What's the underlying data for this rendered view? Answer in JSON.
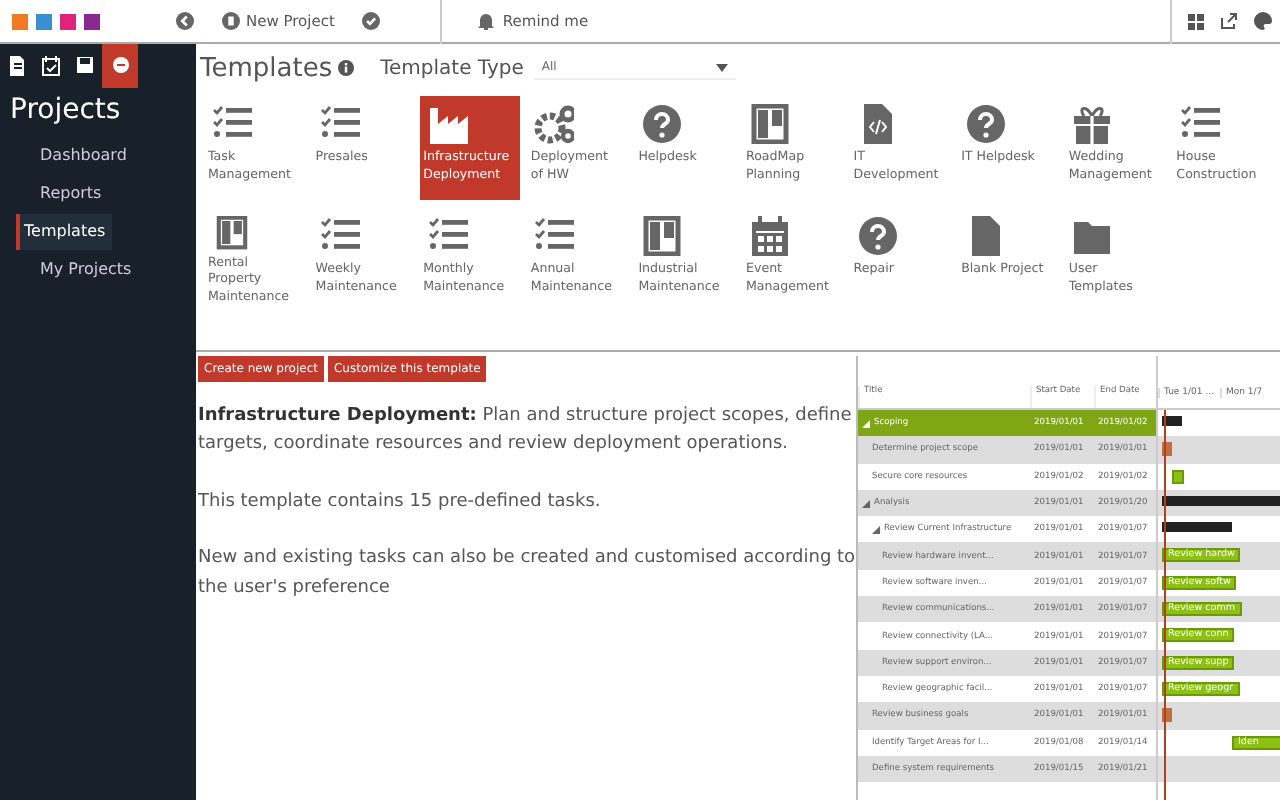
{
  "topbar": {
    "new_project": "New Project",
    "remind": "Remind me"
  },
  "sidebar": {
    "tabs": [
      {
        "kind": "doc",
        "selected": false
      },
      {
        "kind": "calendar",
        "selected": false
      },
      {
        "kind": "save",
        "selected": false
      },
      {
        "kind": "circle",
        "selected": true
      }
    ],
    "title": "Projects",
    "items": [
      {
        "label": "Dashboard",
        "selected": false
      },
      {
        "label": "Reports",
        "selected": false
      },
      {
        "label": "Templates",
        "selected": true
      },
      {
        "label": "My Projects",
        "selected": false
      }
    ]
  },
  "templates": {
    "title": "Templates",
    "filter_label": "Template Type",
    "filter_value": "All",
    "items": [
      {
        "label": "Task Management",
        "kind": "checklist",
        "selected": false
      },
      {
        "label": "Presales",
        "kind": "checklist",
        "selected": false
      },
      {
        "label": "Infrastructure Deployment",
        "kind": "factory",
        "selected": true
      },
      {
        "label": "Deployment of HW",
        "kind": "gears",
        "selected": false
      },
      {
        "label": "Helpdesk",
        "kind": "question",
        "selected": false
      },
      {
        "label": "RoadMap Planning",
        "kind": "board",
        "selected": false
      },
      {
        "label": "IT Development",
        "kind": "code",
        "selected": false
      },
      {
        "label": "IT Helpdesk",
        "kind": "question",
        "selected": false
      },
      {
        "label": "Wedding Management",
        "kind": "gift",
        "selected": false
      },
      {
        "label": "House Construction",
        "kind": "checklist",
        "selected": false
      },
      {
        "label": "Rental Property Maintenance",
        "kind": "board",
        "selected": false
      },
      {
        "label": "Weekly Maintenance",
        "kind": "checklist",
        "selected": false
      },
      {
        "label": "Monthly Maintenance",
        "kind": "checklist",
        "selected": false
      },
      {
        "label": "Annual Maintenance",
        "kind": "checklist",
        "selected": false
      },
      {
        "label": "Industrial Maintenance",
        "kind": "board",
        "selected": false
      },
      {
        "label": "Event Management",
        "kind": "calendar",
        "selected": false
      },
      {
        "label": "Repair",
        "kind": "question",
        "selected": false
      },
      {
        "label": "Blank Project",
        "kind": "file",
        "selected": false
      },
      {
        "label": "User Templates",
        "kind": "folder",
        "selected": false
      }
    ]
  },
  "buttons": [
    "Create new project",
    "Customize this template"
  ],
  "description": [
    "**Infrastructure Deployment:** Plan and structure project scopes, define targets, coordinate resources and review deployment operations.",
    "This template contains 15 pre-defined tasks.",
    "New and existing tasks can also be created and customised according to the user's preference"
  ],
  "gantt": {
    "columns": [
      "Title",
      "Start Date",
      "End Date"
    ],
    "timeline": [
      "Tue 1/01 ...",
      "Mon 1/7"
    ],
    "rows": [
      {
        "title": "Scoping",
        "start": "2019/01/01",
        "end": "2019/01/02",
        "kind": "summary",
        "expanded": true,
        "selected": true,
        "children": [
          {
            "title": "Determine project scope",
            "start": "2019/01/01",
            "end": "2019/01/01",
            "kind": "critical",
            "selected": false
          },
          {
            "title": "Secure core resources",
            "start": "2019/01/02",
            "end": "2019/01/02",
            "kind": "task",
            "selected": false
          }
        ]
      },
      {
        "title": "Analysis",
        "start": "2019/01/01",
        "end": "2019/01/20",
        "kind": "summary",
        "expanded": true,
        "selected": false,
        "children": [
          {
            "title": "Review Current Infrastructure",
            "start": "2019/01/01",
            "end": "2019/01/07",
            "kind": "summary",
            "expanded": true,
            "selected": false,
            "children": [
              {
                "title": "Review hardware invent...",
                "start": "2019/01/01",
                "end": "2019/01/07",
                "kind": "task",
                "bar_label": "Review hardw",
                "selected": false
              },
              {
                "title": "Review software inven...",
                "start": "2019/01/01",
                "end": "2019/01/07",
                "kind": "task",
                "bar_label": "Review softw",
                "selected": false
              },
              {
                "title": "Review communications...",
                "start": "2019/01/01",
                "end": "2019/01/07",
                "kind": "task",
                "bar_label": "Review comm",
                "selected": false
              },
              {
                "title": "Review connectivity (LA...",
                "start": "2019/01/01",
                "end": "2019/01/07",
                "kind": "task",
                "bar_label": "Review conn",
                "selected": false
              },
              {
                "title": "Review support environ...",
                "start": "2019/01/01",
                "end": "2019/01/07",
                "kind": "task",
                "bar_label": "Review supp",
                "selected": false
              },
              {
                "title": "Review geographic facil...",
                "start": "2019/01/01",
                "end": "2019/01/07",
                "kind": "task",
                "bar_label": "Review geogr",
                "selected": false
              }
            ]
          },
          {
            "title": "Review business goals",
            "start": "2019/01/01",
            "end": "2019/01/01",
            "kind": "critical",
            "selected": false
          },
          {
            "title": "Identify Target Areas for I...",
            "start": "2019/01/08",
            "end": "2019/01/14",
            "kind": "task",
            "bar_label": "Iden",
            "selected": false
          },
          {
            "title": "Define system requirements",
            "start": "2019/01/15",
            "end": "2019/01/21",
            "kind": "task",
            "selected": false
          }
        ]
      }
    ]
  }
}
